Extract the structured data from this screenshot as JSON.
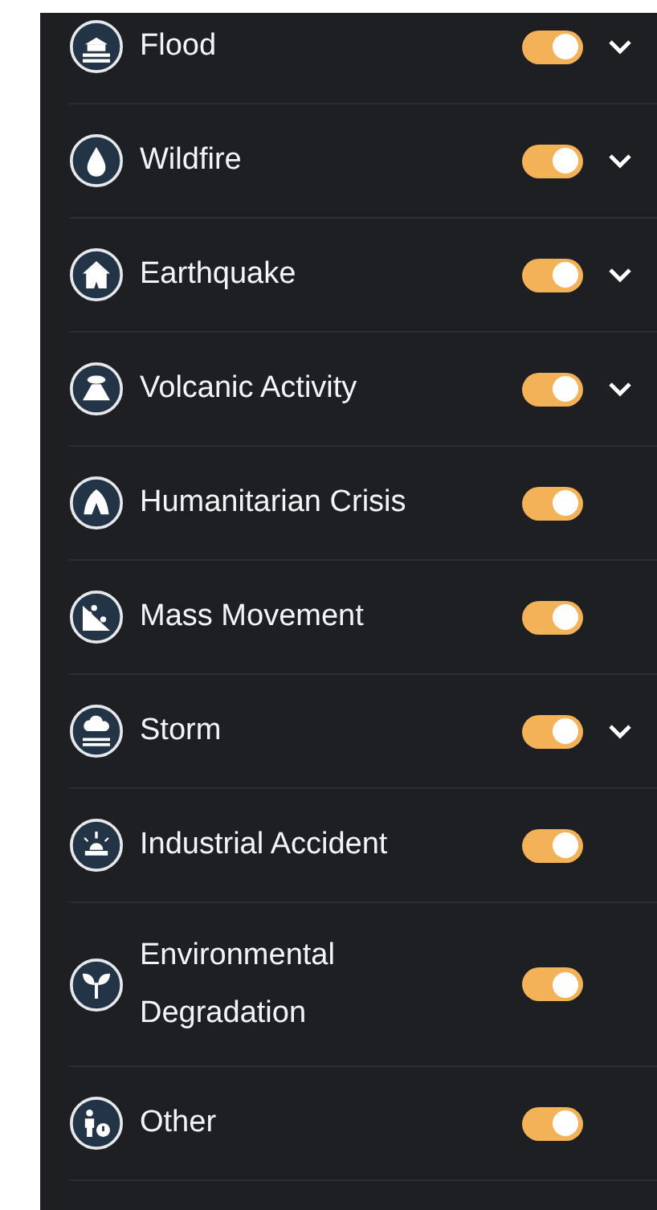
{
  "categories": [
    {
      "label": "Flood",
      "kind": "flood",
      "on": true,
      "expandable": true
    },
    {
      "label": "Wildfire",
      "kind": "drop",
      "on": true,
      "expandable": true
    },
    {
      "label": "Earthquake",
      "kind": "house",
      "on": true,
      "expandable": true
    },
    {
      "label": "Volcanic Activity",
      "kind": "volcano",
      "on": true,
      "expandable": true
    },
    {
      "label": "Humanitarian Crisis",
      "kind": "tent",
      "on": true,
      "expandable": false
    },
    {
      "label": "Mass Movement",
      "kind": "landslide",
      "on": true,
      "expandable": false
    },
    {
      "label": "Storm",
      "kind": "storm",
      "on": true,
      "expandable": true
    },
    {
      "label": "Industrial Accident",
      "kind": "alarm",
      "on": true,
      "expandable": false
    },
    {
      "label": "Environmental Degradation",
      "kind": "sprout",
      "on": true,
      "expandable": false
    },
    {
      "label": "Other",
      "kind": "person",
      "on": true,
      "expandable": false
    }
  ]
}
